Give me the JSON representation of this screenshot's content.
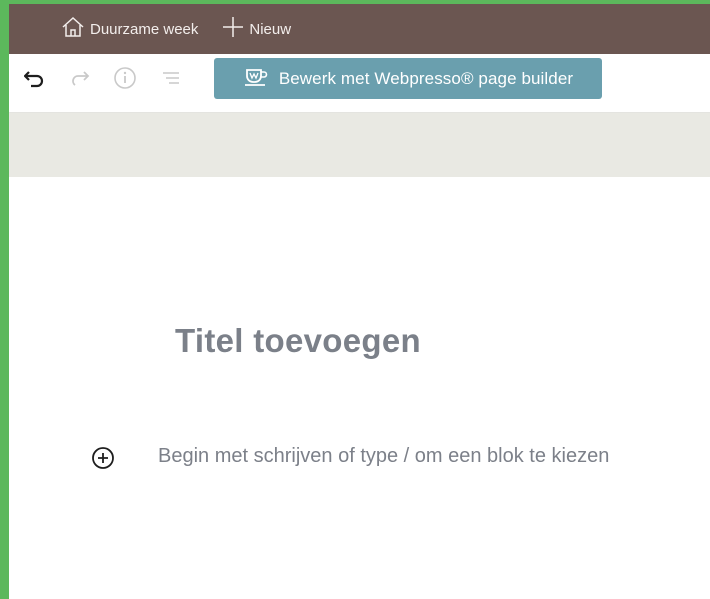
{
  "adminbar": {
    "site_label": "Duurzame week",
    "new_label": "Nieuw"
  },
  "toolbar": {
    "icons": [
      "undo-icon",
      "redo-icon",
      "info-icon",
      "list-view-icon"
    ],
    "webpresso_button_label": "Bewerk met Webpresso® page builder"
  },
  "editor": {
    "title_placeholder": "Titel toevoegen",
    "paragraph_placeholder": "Begin met schrijven of type / om een blok te kiezen"
  },
  "colors": {
    "adminbar_bg": "#6b5651",
    "button_bg": "#6a9fae",
    "band_bg": "#e9e9e3",
    "page_border": "#5cb85c"
  }
}
